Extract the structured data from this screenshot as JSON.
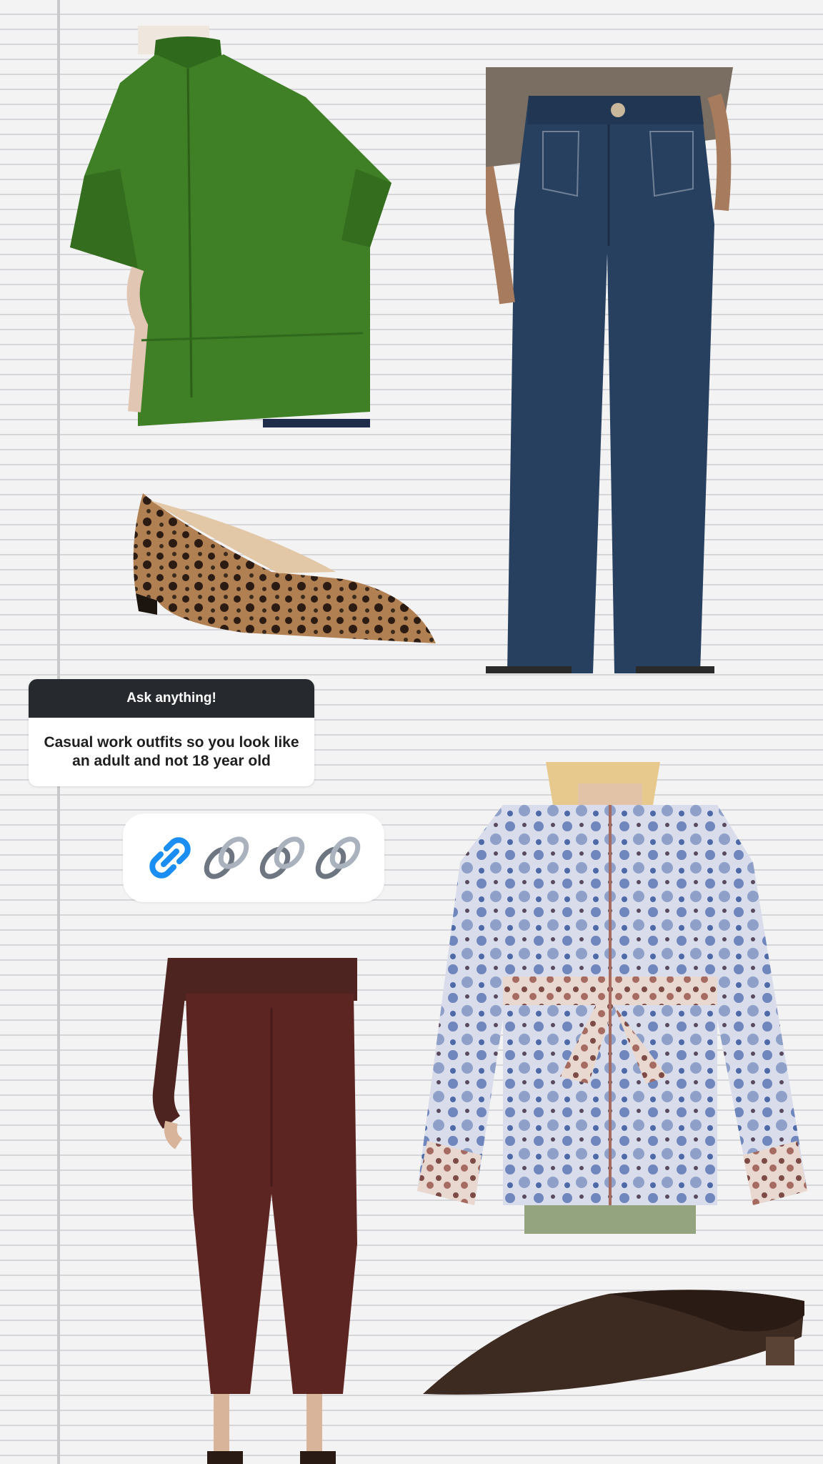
{
  "question_sticker": {
    "header": "Ask anything!",
    "question": "Casual work outfits so you look like an adult and not 18 year old"
  },
  "link_sticker": {
    "icons": [
      "blue-link-icon",
      "chain-link-icon",
      "chain-link-icon",
      "chain-link-icon"
    ],
    "link_color": "#1a8ef2"
  },
  "products": [
    {
      "name": "green-boxy-shirt",
      "color": "#3f7a22"
    },
    {
      "name": "dark-wash-wide-leg-jeans",
      "color": "#25384f"
    },
    {
      "name": "leopard-print-pointed-flat",
      "color": "#a7784e"
    },
    {
      "name": "floral-quilted-belted-jacket",
      "color": "#8ea0c8"
    },
    {
      "name": "burgundy-cropped-pants",
      "color": "#5a2522"
    },
    {
      "name": "brown-suede-mule",
      "color": "#3d2a20"
    }
  ],
  "colors": {
    "background": "#f3f3f4",
    "sticker_header": "#262a2e",
    "sticker_body": "#ffffff"
  }
}
